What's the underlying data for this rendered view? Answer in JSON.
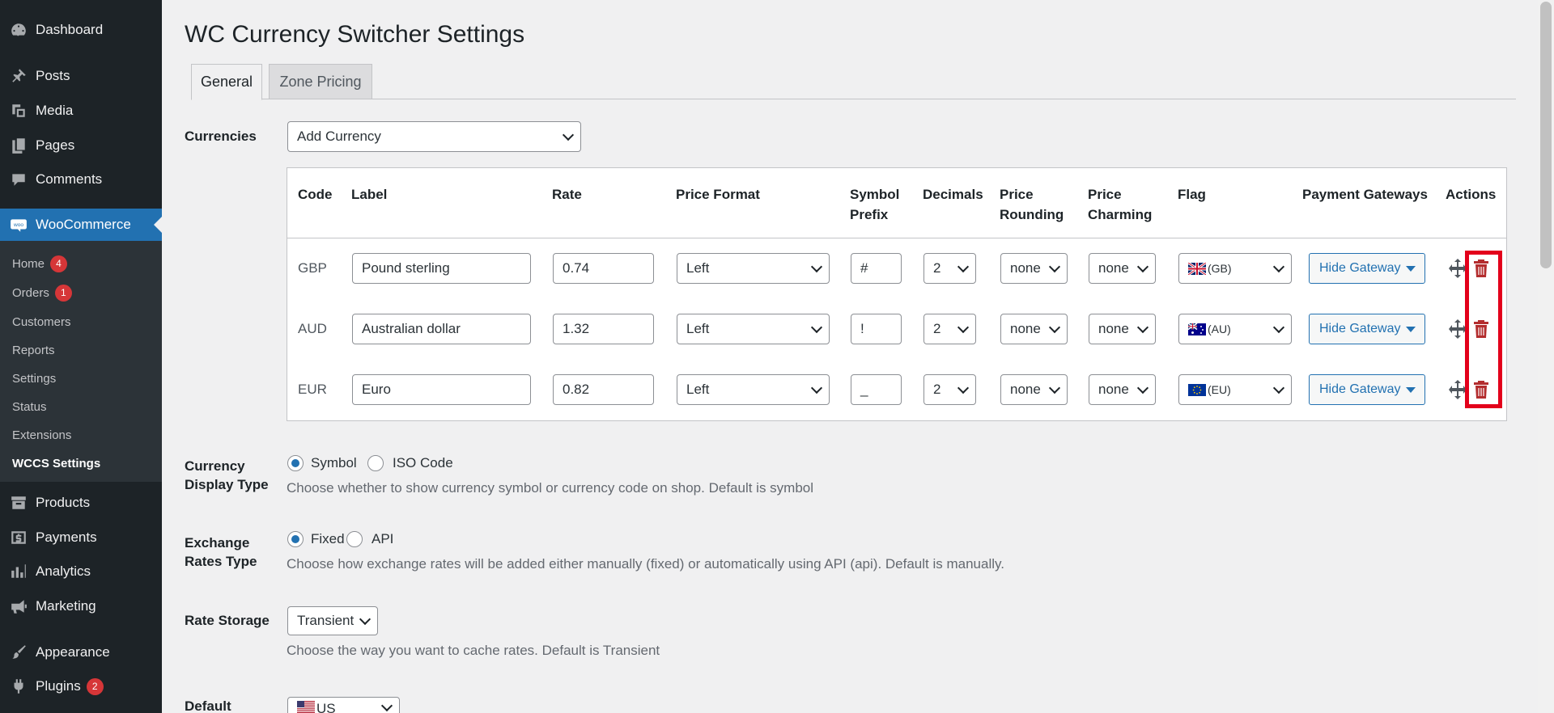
{
  "sidebar": {
    "items": [
      {
        "label": "Dashboard",
        "icon": "dashboard-icon"
      },
      {
        "label": "Posts",
        "icon": "pin-icon"
      },
      {
        "label": "Media",
        "icon": "media-icon"
      },
      {
        "label": "Pages",
        "icon": "pages-icon"
      },
      {
        "label": "Comments",
        "icon": "comment-icon"
      },
      {
        "label": "WooCommerce",
        "icon": "woo-icon"
      },
      {
        "label": "Products",
        "icon": "archive-icon"
      },
      {
        "label": "Payments",
        "icon": "dollar-icon"
      },
      {
        "label": "Analytics",
        "icon": "chart-bar-icon"
      },
      {
        "label": "Marketing",
        "icon": "megaphone-icon"
      },
      {
        "label": "Appearance",
        "icon": "paintbrush-icon"
      },
      {
        "label": "Plugins",
        "icon": "plugin-icon",
        "badge": "2"
      }
    ],
    "woo_submenu": [
      {
        "label": "Home",
        "badge": "4"
      },
      {
        "label": "Orders",
        "badge": "1"
      },
      {
        "label": "Customers"
      },
      {
        "label": "Reports"
      },
      {
        "label": "Settings"
      },
      {
        "label": "Status"
      },
      {
        "label": "Extensions"
      },
      {
        "label": "WCCS Settings"
      }
    ]
  },
  "page": {
    "title": "WC Currency Switcher Settings",
    "tabs": [
      "General",
      "Zone Pricing"
    ]
  },
  "currencies": {
    "label": "Currencies",
    "add_select": "Add Currency",
    "headers": {
      "code": "Code",
      "label": "Label",
      "rate": "Rate",
      "price_format": "Price Format",
      "symbol_prefix": [
        "Symbol",
        "Prefix"
      ],
      "decimals": "Decimals",
      "price_rounding": [
        "Price",
        "Rounding"
      ],
      "price_charming": [
        "Price",
        "Charming"
      ],
      "flag": "Flag",
      "payment_gateways": "Payment Gateways",
      "actions": "Actions"
    },
    "rows": [
      {
        "code": "GBP",
        "label": "Pound sterling",
        "rate": "0.74",
        "format": "Left",
        "prefix": "#",
        "decimals": "2",
        "rounding": "none",
        "charming": "none",
        "flag": "(GB)",
        "gateway": "Hide Gateway"
      },
      {
        "code": "AUD",
        "label": "Australian dollar",
        "rate": "1.32",
        "format": "Left",
        "prefix": "!",
        "decimals": "2",
        "rounding": "none",
        "charming": "none",
        "flag": "(AU)",
        "gateway": "Hide Gateway"
      },
      {
        "code": "EUR",
        "label": "Euro",
        "rate": "0.82",
        "format": "Left",
        "prefix": "_",
        "decimals": "2",
        "rounding": "none",
        "charming": "none",
        "flag": "(EU)",
        "gateway": "Hide Gateway"
      }
    ]
  },
  "display_type": {
    "label_line1": "Currency",
    "label_line2": "Display Type",
    "options": [
      "Symbol",
      "ISO Code"
    ],
    "help": "Choose whether to show currency symbol or currency code on shop. Default is symbol"
  },
  "exchange_type": {
    "label_line1": "Exchange",
    "label_line2": "Rates Type",
    "options": [
      "Fixed",
      "API"
    ],
    "help": "Choose how exchange rates will be added either manually (fixed) or automatically using API (api). Default is manually."
  },
  "rate_storage": {
    "label": "Rate Storage",
    "value": "Transient",
    "help": "Choose the way you want to cache rates. Default is Transient"
  },
  "default_currency": {
    "label": "Default",
    "value": "US"
  },
  "colors": {
    "sidebar_bg": "#1d2327",
    "accent": "#2271b1",
    "delete": "#b32d2e",
    "highlight": "#e3001b"
  }
}
